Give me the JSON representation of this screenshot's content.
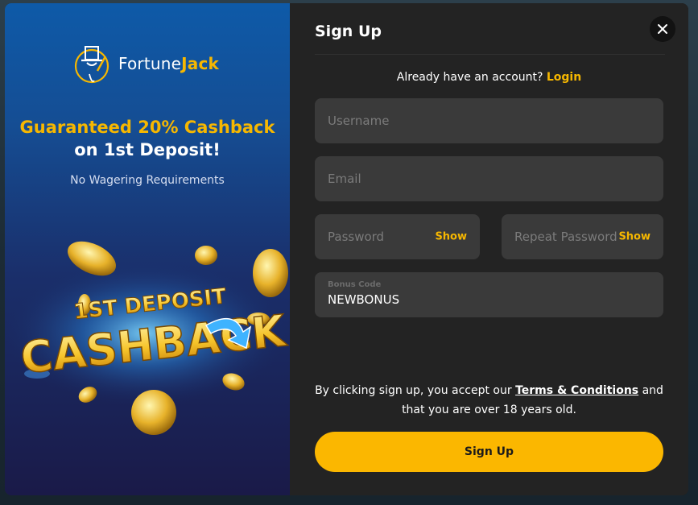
{
  "promo": {
    "brand_plain": "Fortune",
    "brand_bold": "Jack",
    "headline_line1": "Guaranteed 20% Cashback",
    "headline_line2": "on 1st Deposit!",
    "subline": "No Wagering Requirements",
    "art_line1": "1ST DEPOSIT",
    "art_line2": "CASHBACK"
  },
  "form": {
    "title": "Sign Up",
    "have_account": "Already have an account?",
    "login_link": "Login",
    "username_placeholder": "Username",
    "email_placeholder": "Email",
    "password_placeholder": "Password",
    "repeat_password_placeholder": "Repeat Password",
    "show_label": "Show",
    "bonus_label": "Bonus Code",
    "bonus_value": "NEWBONUS",
    "terms_prefix": "By clicking sign up, you accept our",
    "terms_link": "Terms & Conditions",
    "terms_suffix": "and that you are over 18 years old.",
    "submit_label": "Sign Up"
  },
  "colors": {
    "accent": "#f6b700",
    "panel": "#232323",
    "input": "#3a3a3a"
  },
  "icons": {
    "close": "close-icon",
    "logo": "fortunejack-logo-icon"
  }
}
